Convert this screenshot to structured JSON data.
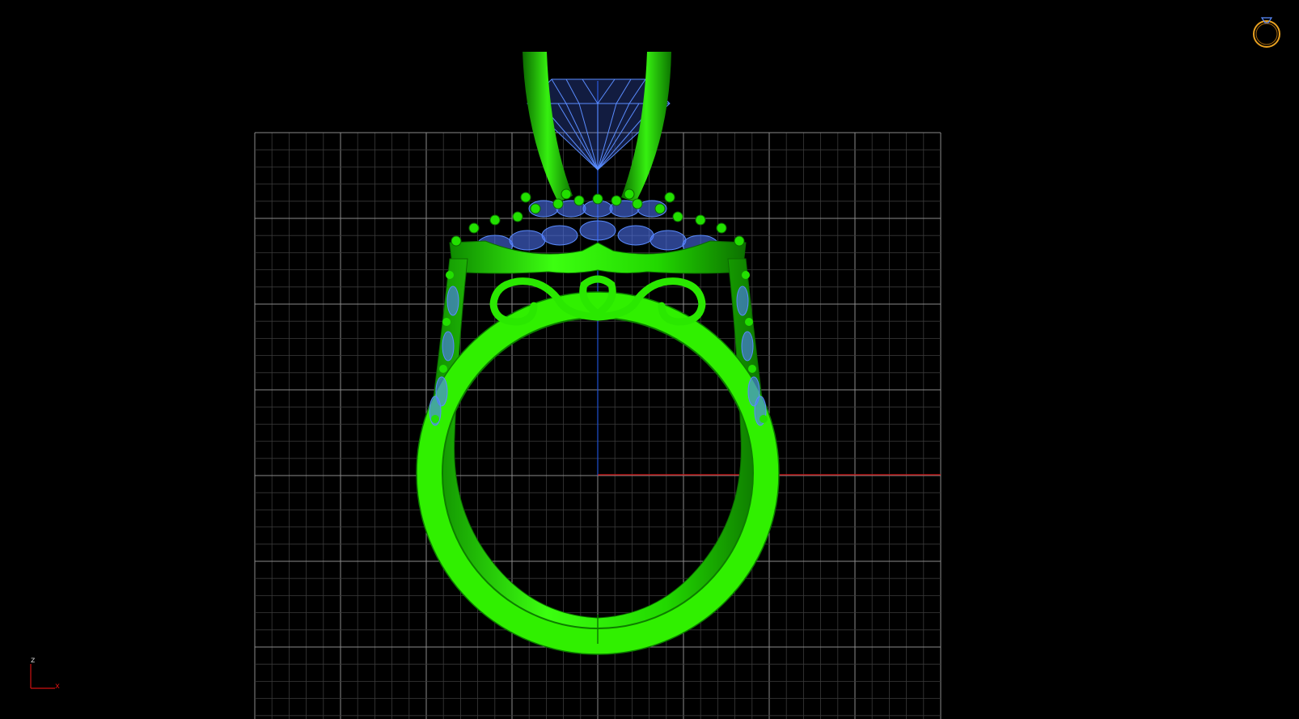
{
  "viewport": {
    "view": "front",
    "background": "#000000",
    "grid_color": "#8a8a8a",
    "grid_fine_color": "#3a3a3a",
    "x_axis_color": "#d01010",
    "z_axis_color": "#1f4fd0"
  },
  "model": {
    "metal_color": "#22e000",
    "metal_shadow": "#0f7a00",
    "gem_color": "#5a8cff"
  },
  "axis_triad": {
    "vertical_label": "z",
    "horizontal_label": "x",
    "vertical_color": "#d01010",
    "horizontal_color": "#d01010"
  },
  "nav_widget": {
    "icon": "ring-icon",
    "color": "#e8a020"
  }
}
